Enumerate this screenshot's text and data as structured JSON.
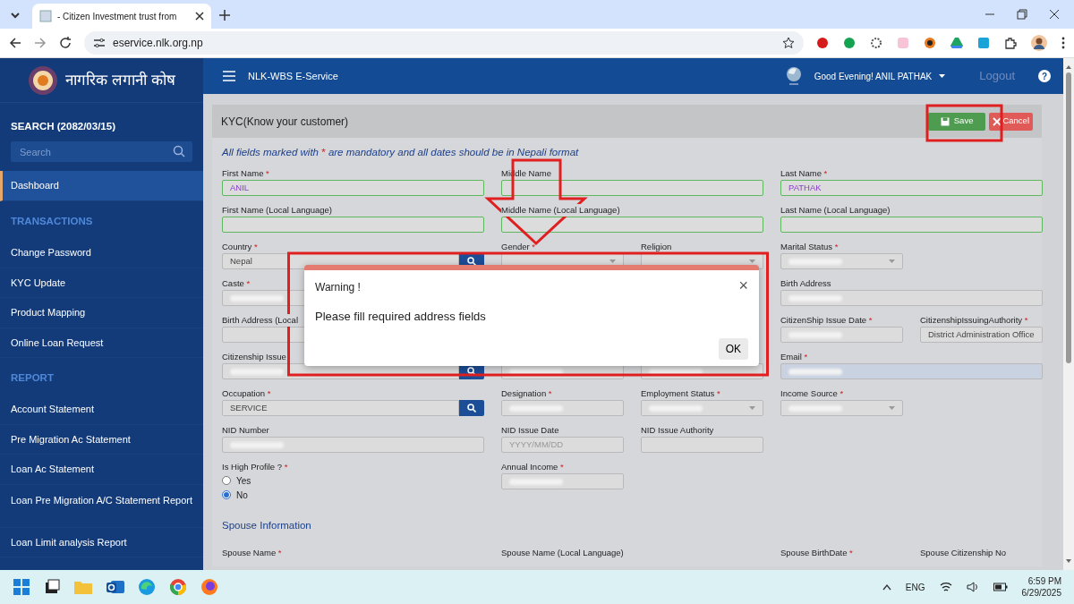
{
  "browser": {
    "tab_title": "- Citizen Investment trust from",
    "address": "eservice.nlk.org.np"
  },
  "sidebar": {
    "logo_text": "नागरिक लगानी कोष",
    "search_label": "SEARCH (2082/03/15)",
    "search_placeholder": "Search",
    "items": [
      {
        "kind": "link",
        "label": "Dashboard",
        "selected": true
      },
      {
        "kind": "heading",
        "label": "TRANSACTIONS"
      },
      {
        "kind": "link",
        "label": "Change Password",
        "selected": false
      },
      {
        "kind": "link",
        "label": "KYC Update",
        "selected": false
      },
      {
        "kind": "link",
        "label": "Product Mapping",
        "selected": false
      },
      {
        "kind": "link",
        "label": "Online Loan Request",
        "selected": false
      },
      {
        "kind": "heading",
        "label": "REPORT"
      },
      {
        "kind": "link",
        "label": "Account Statement",
        "selected": false
      },
      {
        "kind": "link",
        "label": "Pre Migration Ac Statement",
        "selected": false
      },
      {
        "kind": "link",
        "label": "Loan Ac Statement",
        "selected": false
      },
      {
        "kind": "link",
        "label": "Loan Pre Migration A/C Statement Report",
        "selected": false
      },
      {
        "kind": "link",
        "label": "Loan Limit analysis Report",
        "selected": false
      }
    ]
  },
  "navbar": {
    "app_title": "NLK-WBS E-Service",
    "greeting": "Good Evening! ANIL PATHAK",
    "logout": "Logout",
    "help": "?"
  },
  "panel": {
    "title": "KYC(Know your customer)",
    "buttons": [
      {
        "kind": "save",
        "label": "Save"
      },
      {
        "kind": "cancel",
        "label": "Cancel"
      }
    ],
    "note": {
      "before": "All fields marked with",
      "mark": "*",
      "after": "are mandatory and all dates should be in Nepali format"
    },
    "rows": [
      [
        {
          "kind": "text",
          "label": "First Name",
          "mark": "*",
          "value": "ANIL",
          "valid": true
        },
        {
          "kind": "text",
          "label": "Middle Name",
          "valid": true
        },
        {
          "kind": "text",
          "label": "Last Name",
          "mark": "*",
          "value": "PATHAK",
          "valid": true
        }
      ],
      [
        {
          "kind": "text",
          "label": "First Name (Local Language)",
          "valid": true
        },
        {
          "kind": "text",
          "label": "Middle Name (Local Language)",
          "valid": true
        },
        {
          "kind": "text",
          "label": "Last Name (Local Language)",
          "valid": true
        }
      ],
      [
        {
          "kind": "search",
          "label": "Country",
          "mark": "*",
          "value": "Nepal"
        },
        {
          "kind": "select",
          "label": "Gender",
          "mark": "*"
        },
        {
          "kind": "select",
          "label": "Religion"
        },
        {
          "kind": "select",
          "label": "Marital Status",
          "mark": "*",
          "redacted": true
        }
      ],
      [
        {
          "kind": "text",
          "label": "Caste",
          "mark": "*",
          "redacted": true
        },
        {
          "kind": "text",
          "label": "Birth Address",
          "redacted": true
        }
      ],
      [
        {
          "kind": "text",
          "label": "Birth Address (Local"
        },
        {
          "kind": "text",
          "label": "CitizenShip Issue Date",
          "mark": "*",
          "redacted": true
        },
        {
          "kind": "text",
          "label": "CitizenshipIssuingAuthority",
          "mark": "*",
          "value": "District Administration Office"
        }
      ],
      [
        {
          "kind": "search",
          "label": "Citizenship Issue",
          "redacted": true
        },
        {
          "kind": "text",
          "redacted": true
        },
        {
          "kind": "text",
          "redacted": true
        },
        {
          "kind": "email",
          "label": "Email",
          "mark": "*",
          "redacted": true
        }
      ],
      [
        {
          "kind": "search",
          "label": "Occupation",
          "mark": "*",
          "value": "SERVICE"
        },
        {
          "kind": "text",
          "label": "Designation",
          "mark": "*",
          "redacted": true
        },
        {
          "kind": "select",
          "label": "Employment Status",
          "mark": "*",
          "redacted": true
        },
        {
          "kind": "select",
          "label": "Income Source",
          "mark": "*",
          "redacted": true
        }
      ],
      [
        {
          "kind": "text",
          "label": "NID Number",
          "redacted": true
        },
        {
          "kind": "text",
          "label": "NID Issue Date",
          "placeholder": "YYYY/MM/DD"
        },
        {
          "kind": "text",
          "label": "NID Issue Authority"
        }
      ],
      [
        {
          "kind": "radio",
          "label": "Is High Profile ?",
          "mark": "*",
          "options": [
            {
              "label": "Yes",
              "selected": false
            },
            {
              "label": "No",
              "selected": true
            }
          ]
        },
        {
          "kind": "text",
          "label": "Annual Income",
          "mark": "*",
          "redacted": true
        }
      ]
    ],
    "spouse_heading": "Spouse Information",
    "spouse_labels": [
      {
        "label": "Spouse Name",
        "mark": "*"
      },
      {
        "label": "Spouse Name (Local Language)"
      },
      {
        "label": "Spouse BirthDate",
        "mark": "*"
      },
      {
        "label": "Spouse Citizenship No"
      }
    ]
  },
  "modal": {
    "title": "Warning !",
    "close": "×",
    "message": "Please fill required address fields",
    "ok": "OK"
  },
  "taskbar": {
    "lang": "ENG",
    "time": "6:59 PM",
    "date": "6/29/2025"
  }
}
